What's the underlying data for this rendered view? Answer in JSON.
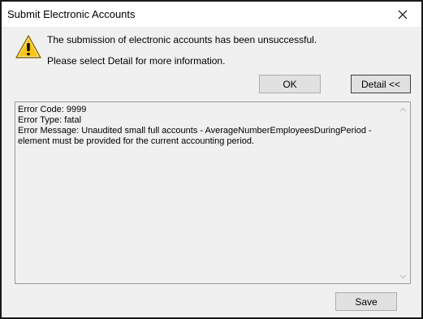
{
  "window": {
    "title": "Submit Electronic Accounts"
  },
  "message": {
    "line1": "The submission of electronic accounts has been unsuccessful.",
    "line2": "Please select Detail for more information.",
    "icon": "warning-icon"
  },
  "buttons": {
    "ok_label": "OK",
    "detail_label": "Detail <<",
    "save_label": "Save"
  },
  "details": {
    "error_code": "Error Code: 9999",
    "error_type": "Error Type: fatal",
    "error_message": "Error Message: Unaudited small full accounts - AverageNumberEmployeesDuringPeriod - element must be provided for the current accounting period."
  },
  "colors": {
    "dialog_background": "#f0f0f0",
    "warning_yellow": "#f5c518",
    "button_face": "#e1e1e1"
  }
}
